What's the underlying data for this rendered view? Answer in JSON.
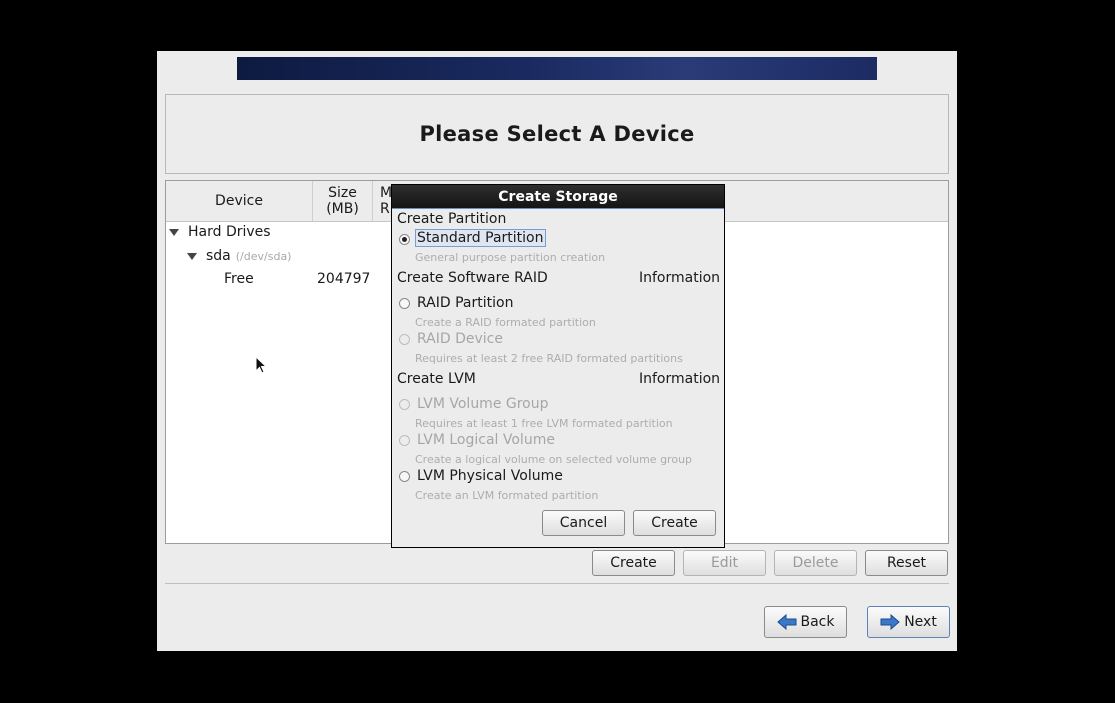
{
  "header": {
    "title": "Please Select A Device"
  },
  "tree": {
    "columns": {
      "device": "Device",
      "size_line1": "Size",
      "size_line2": "(MB)",
      "mount_line1": "M",
      "mount_line2": "R"
    },
    "rows": {
      "group": "Hard Drives",
      "disk": "sda",
      "disk_path": "(/dev/sda)",
      "free_label": "Free",
      "free_size": "204797"
    }
  },
  "actions": {
    "create": "Create",
    "edit": "Edit",
    "delete": "Delete",
    "reset": "Reset"
  },
  "nav": {
    "back": "Back",
    "next": "Next"
  },
  "dialog": {
    "title": "Create Storage",
    "section_partition": "Create Partition",
    "standard_partition": "Standard Partition",
    "standard_partition_desc": "General purpose partition creation",
    "section_raid": "Create Software RAID",
    "raid_info": "Information",
    "raid_partition": "RAID Partition",
    "raid_partition_desc": "Create a RAID formated partition",
    "raid_device": "RAID Device",
    "raid_device_desc": "Requires at least 2 free RAID formated partitions",
    "section_lvm": "Create LVM",
    "lvm_info": "Information",
    "lvm_volume_group": "LVM Volume Group",
    "lvm_volume_group_desc": "Requires at least 1 free LVM formated partition",
    "lvm_logical_volume": "LVM Logical Volume",
    "lvm_logical_volume_desc": "Create a logical volume on selected volume group",
    "lvm_physical_volume": "LVM Physical Volume",
    "lvm_physical_volume_desc": "Create an LVM formated partition",
    "cancel": "Cancel",
    "create": "Create"
  }
}
